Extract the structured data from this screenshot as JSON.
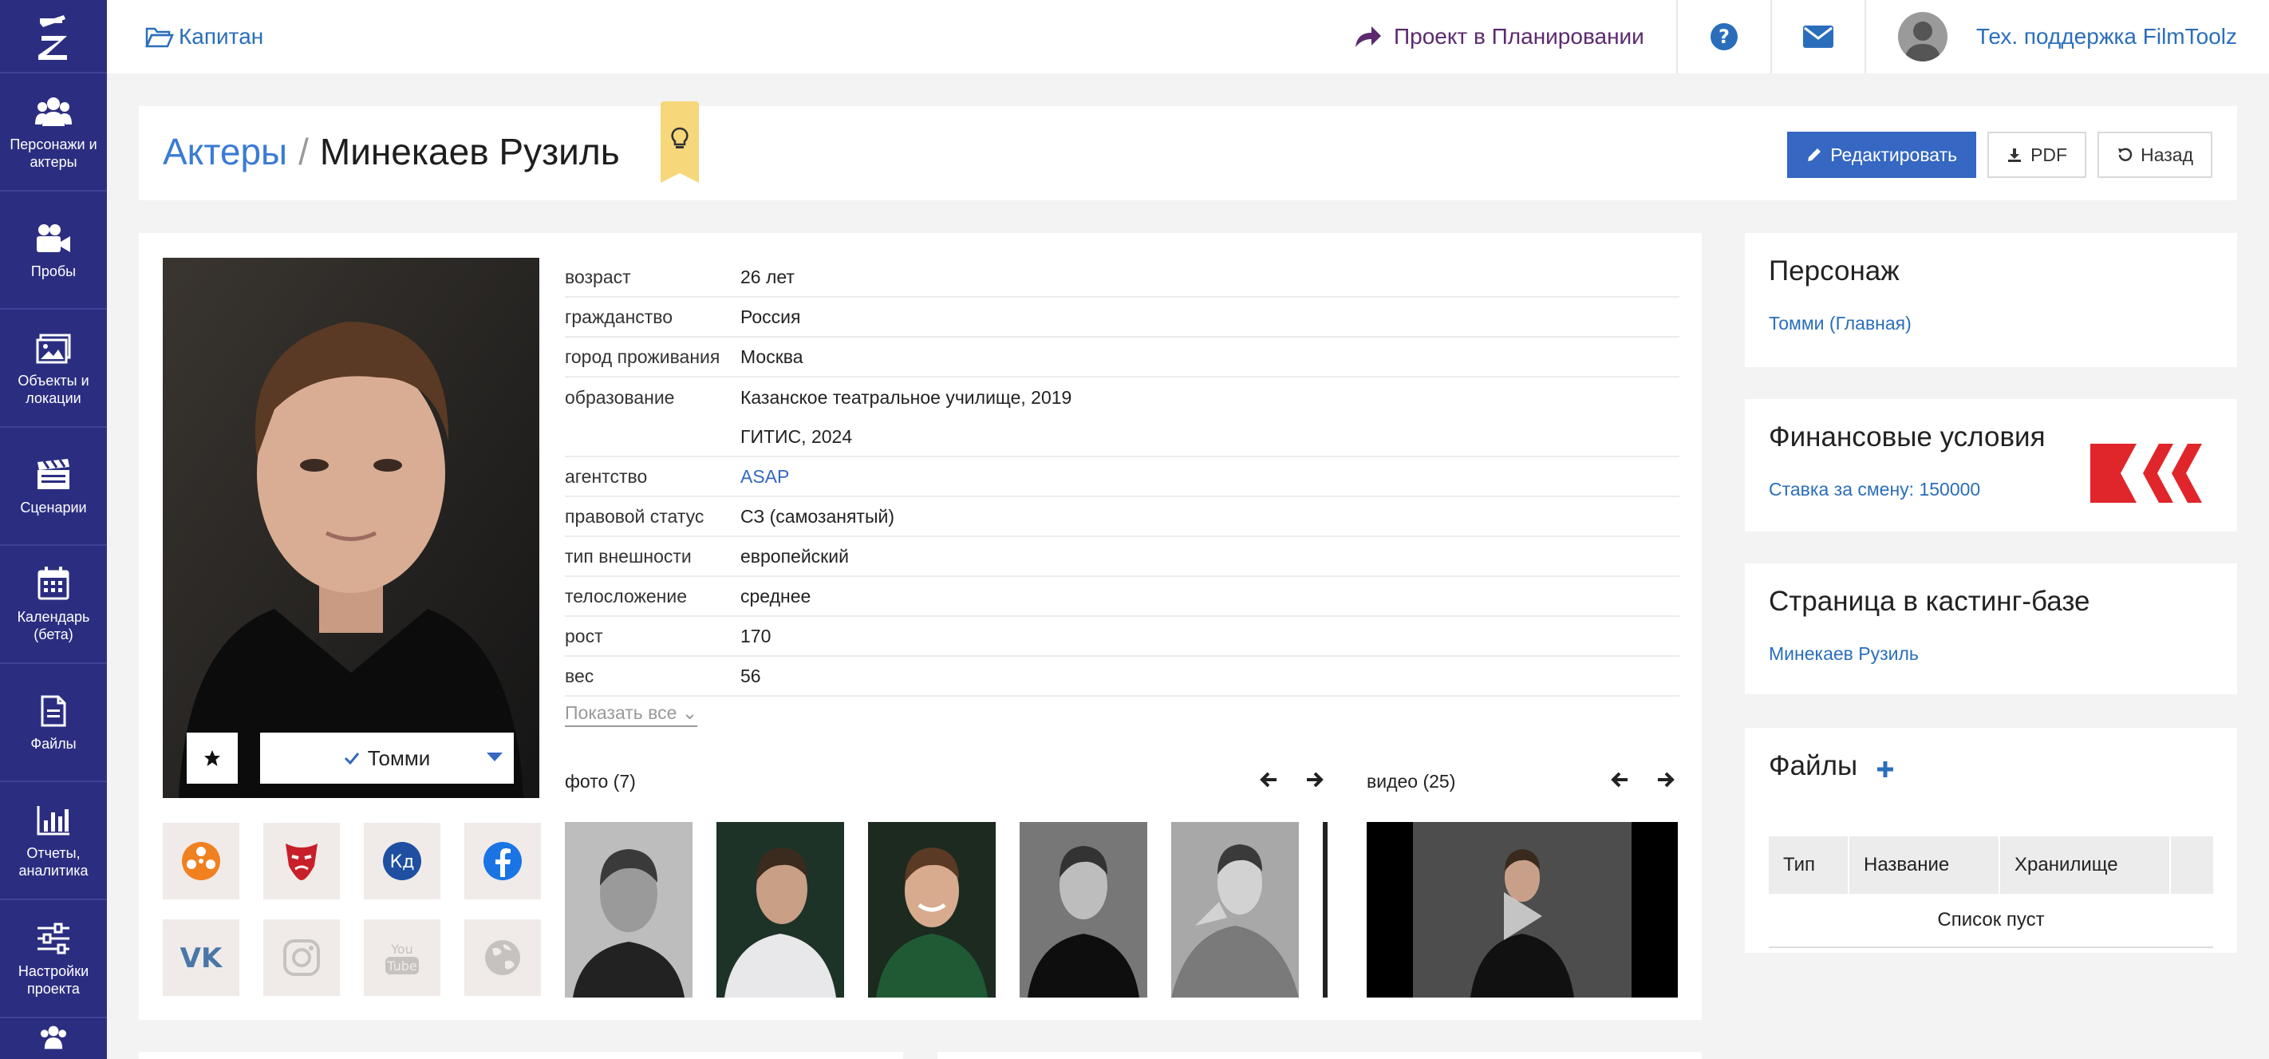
{
  "sidebar": {
    "items": [
      {
        "label": "Персонажи и актеры",
        "icon": "users-icon"
      },
      {
        "label": "Пробы",
        "icon": "video-camera-icon"
      },
      {
        "label": "Объекты и локации",
        "icon": "image-icon"
      },
      {
        "label": "Сценарии",
        "icon": "clapperboard-icon"
      },
      {
        "label": "Календарь (бета)",
        "icon": "calendar-icon"
      },
      {
        "label": "Файлы",
        "icon": "file-icon"
      },
      {
        "label": "Отчеты, аналитика",
        "icon": "bar-chart-icon"
      },
      {
        "label": "Настройки проекта",
        "icon": "sliders-icon"
      }
    ]
  },
  "topbar": {
    "crumb": "Капитан",
    "project_status": "Проект в Планировании",
    "support": "Тех. поддержка FilmToolz"
  },
  "header": {
    "crumb": "Актеры",
    "separator": "/",
    "name": "Минекаев Рузиль",
    "edit": "Редактировать",
    "pdf": "PDF",
    "back": "Назад"
  },
  "actor": {
    "role_button": "Томми",
    "attributes": [
      {
        "k": "возраст",
        "v": "26 лет"
      },
      {
        "k": "гражданство",
        "v": "Россия"
      },
      {
        "k": "город проживания",
        "v": "Москва"
      },
      {
        "k": "образование",
        "v": "Казанское театральное училище, 2019",
        "extra": "ГИТИС, 2024"
      },
      {
        "k": "агентство",
        "v": "ASAP"
      },
      {
        "k": "правовой статус",
        "v": "СЗ (самозанятый)"
      },
      {
        "k": "тип внешности",
        "v": "европейский"
      },
      {
        "k": "телосложение",
        "v": "среднее"
      },
      {
        "k": "рост",
        "v": "170"
      },
      {
        "k": "вес",
        "v": "56"
      }
    ],
    "show_all": "Показать все",
    "photos_label": "фото (7)",
    "video_label": "видео (25)"
  },
  "right": {
    "character_title": "Персонаж",
    "character_link": "Томми (Главная)",
    "finance_title": "Финансовые условия",
    "finance_link": "Ставка за смену: 150000",
    "casting_title": "Страница в кастинг-базе",
    "casting_link": "Минекаев Рузиль",
    "files_title": "Файлы",
    "files_cols": [
      "Тип",
      "Название",
      "Хранилище"
    ],
    "files_empty": "Список пуст"
  },
  "colors": {
    "sidebar": "#2b2e80",
    "primary": "#3567c3",
    "link": "#2a6ebb",
    "accent_red": "#e0262b"
  }
}
